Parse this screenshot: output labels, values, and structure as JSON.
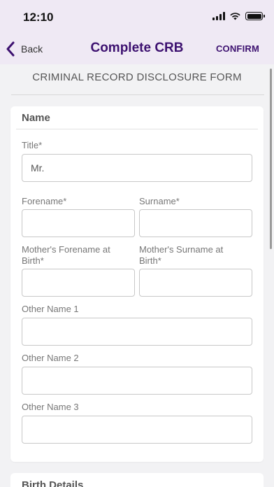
{
  "status_bar": {
    "time": "12:10"
  },
  "nav": {
    "back_label": "Back",
    "title": "Complete CRB",
    "confirm_label": "CONFIRM",
    "accent_color": "#3d1170",
    "bar_color": "#efe9f4"
  },
  "form": {
    "heading": "CRIMINAL RECORD DISCLOSURE FORM",
    "sections": [
      {
        "title": "Name",
        "fields": [
          {
            "label": "Title*",
            "value": "Mr."
          },
          {
            "label": "Forename*",
            "value": ""
          },
          {
            "label": "Surname*",
            "value": ""
          },
          {
            "label": "Mother's Forename at Birth*",
            "value": ""
          },
          {
            "label": "Mother's Surname at Birth*",
            "value": ""
          },
          {
            "label": "Other Name 1",
            "value": ""
          },
          {
            "label": "Other Name 2",
            "value": ""
          },
          {
            "label": "Other Name 3",
            "value": ""
          }
        ]
      },
      {
        "title": "Birth Details"
      }
    ]
  },
  "icons": [
    "chevron-left-icon",
    "signal-icon",
    "wifi-icon",
    "battery-icon"
  ]
}
